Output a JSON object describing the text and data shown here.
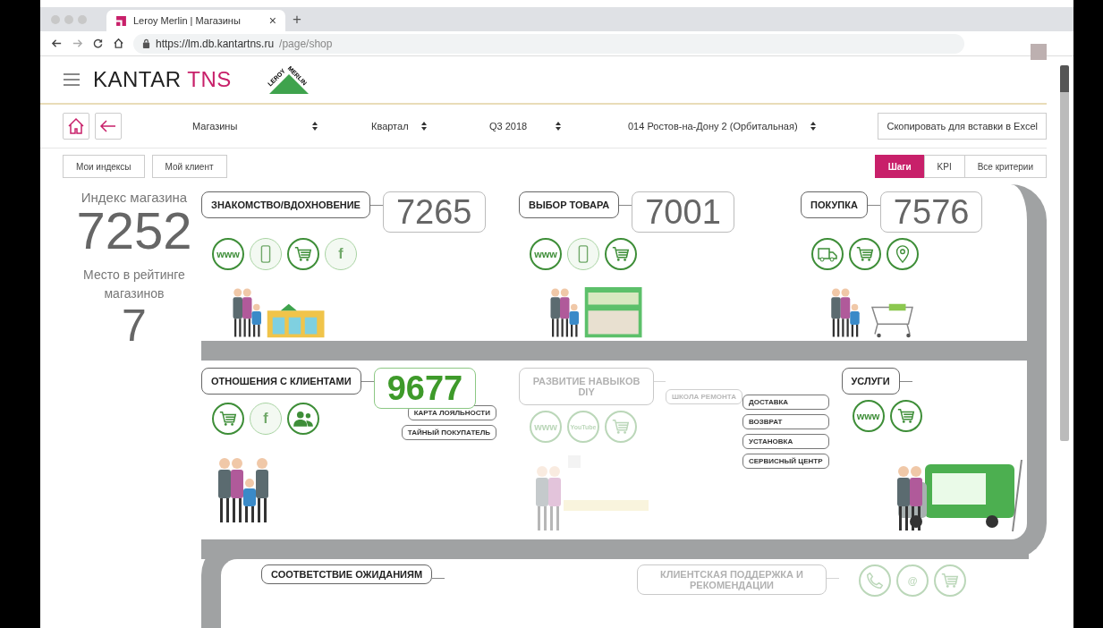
{
  "browser": {
    "tab_title": "Leroy Merlin | Магазины",
    "new_tab": "+",
    "close_tab": "×",
    "url_host": "https://lm.db.kantartns.ru",
    "url_path": "/page/shop"
  },
  "header": {
    "brand": "KANTAR",
    "brand_accent": "TNS",
    "partner_top": "LEROY",
    "partner_side": "MERLIN"
  },
  "toolbar": {
    "selects": [
      {
        "value": "Магазины"
      },
      {
        "value": "Квартал"
      },
      {
        "value": "Q3 2018"
      },
      {
        "value": "014 Ростов-на-Дону 2 (Орбитальная)"
      }
    ],
    "copy_button": "Скопировать для вставки в Excel"
  },
  "view_buttons": [
    "Мои индексы",
    "Мой клиент"
  ],
  "mode_tabs": [
    {
      "label": "Шаги",
      "selected": true
    },
    {
      "label": "KPI",
      "selected": false
    },
    {
      "label": "Все критерии",
      "selected": false
    }
  ],
  "summary": {
    "index_label": "Индекс магазина",
    "index_value": "7252",
    "rank_label": "Место в рейтинге магазинов",
    "rank_value": "7"
  },
  "rows": [
    {
      "stages": [
        {
          "title": "ЗНАКОМСТВО/ВДОХНОВЕНИЕ",
          "score": "7265",
          "highlighted": false,
          "faded": false,
          "illustration": {
            "kind": "storefront"
          },
          "icons": [
            {
              "kind": "text",
              "text": "www",
              "active": true
            },
            {
              "kind": "mobile",
              "active": false
            },
            {
              "kind": "cart",
              "active": true
            },
            {
              "kind": "text",
              "text": "f",
              "active": false
            }
          ]
        },
        {
          "title": "ВЫБОР ТОВАРА",
          "score": "7001",
          "highlighted": false,
          "faded": false,
          "illustration": {
            "kind": "shelf"
          },
          "icons": [
            {
              "kind": "text",
              "text": "www",
              "active": true
            },
            {
              "kind": "mobile",
              "active": false
            },
            {
              "kind": "cart",
              "active": true
            }
          ]
        },
        {
          "title": "ПОКУПКА",
          "score": "7576",
          "highlighted": false,
          "faded": false,
          "illustration": {
            "kind": "cart"
          },
          "icons": [
            {
              "kind": "truck",
              "active": true
            },
            {
              "kind": "cart",
              "active": true
            },
            {
              "kind": "pin",
              "active": true
            }
          ]
        }
      ]
    },
    {
      "stages": [
        {
          "title": "ОТНОШЕНИЯ С КЛИЕНТАМИ",
          "score": "9677",
          "highlighted": true,
          "faded": false,
          "illustration": {
            "kind": "handshake"
          },
          "sub_items": [
            "КАРТА ЛОЯЛЬНОСТИ",
            "ТАЙНЫЙ ПОКУПАТЕЛЬ"
          ],
          "icons": [
            {
              "kind": "cart",
              "active": true
            },
            {
              "kind": "text",
              "text": "f",
              "active": false
            },
            {
              "kind": "people",
              "active": true
            }
          ]
        },
        {
          "title": "РАЗВИТИЕ НАВЫКОВ DIY",
          "faded": true,
          "illustration": {
            "kind": "workshop"
          },
          "sub_items": [
            "ШКОЛА РЕМОНТА"
          ],
          "icons": [
            {
              "kind": "text",
              "text": "www",
              "active": true
            },
            {
              "kind": "text",
              "text": "YouTube",
              "active": true
            },
            {
              "kind": "cart",
              "active": true
            }
          ]
        },
        {
          "title": "УСЛУГИ",
          "faded": false,
          "illustration": {
            "kind": "van"
          },
          "sub_items": [
            "ДОСТАВКА",
            "ВОЗВРАТ",
            "УСТАНОВКА",
            "СЕРВИСНЫЙ ЦЕНТР"
          ],
          "icons": [
            {
              "kind": "text",
              "text": "www",
              "active": true
            },
            {
              "kind": "cart",
              "active": true
            }
          ]
        }
      ]
    },
    {
      "stages": [
        {
          "title": "СООТВЕТСТВИЕ ОЖИДАНИЯМ",
          "faded": false
        },
        {
          "title": "КЛИЕНТСКАЯ ПОДДЕРЖКА И РЕКОМЕНДАЦИИ",
          "faded": true,
          "icons": [
            {
              "kind": "handset",
              "active": true
            },
            {
              "kind": "text",
              "text": "@",
              "active": true
            },
            {
              "kind": "cart",
              "active": true
            }
          ]
        }
      ]
    }
  ]
}
